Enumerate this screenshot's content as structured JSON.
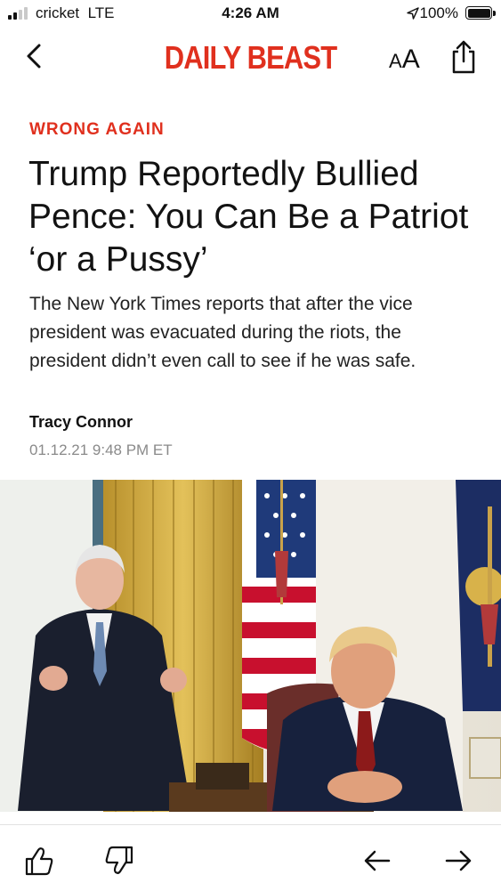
{
  "status_bar": {
    "carrier": "cricket",
    "network": "LTE",
    "time": "4:26 AM",
    "battery_percent": "100%"
  },
  "nav": {
    "logo": "DAILY BEAST",
    "text_size_small": "A",
    "text_size_large": "A",
    "icons": [
      "chevron-left-icon",
      "share-icon"
    ]
  },
  "article": {
    "kicker": "WRONG AGAIN",
    "headline": "Trump Reportedly Bullied Pence: You Can Be a Patriot ‘or a Pussy’",
    "dek": "The New York Times reports that after the vice president was evacuated during the riots, the president didn’t even call to see if he was safe.",
    "author": "Tracy Connor",
    "date": "01.12.21 9:48 PM ET"
  },
  "toolbar": {
    "icons": [
      "thumbs-up-icon",
      "thumbs-down-icon",
      "arrow-left-icon",
      "arrow-right-icon"
    ]
  },
  "colors": {
    "brand_red": "#e0301e",
    "text": "#121212",
    "muted": "#8a8a8a"
  }
}
